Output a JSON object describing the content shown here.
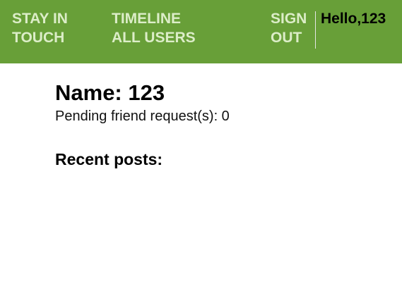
{
  "nav": {
    "brand_line1": "STAY IN",
    "brand_line2": "TOUCH",
    "timeline_label": "TIMELINE",
    "all_users_label": "ALL USERS",
    "signout_line1": "SIGN",
    "signout_line2": "OUT",
    "greeting": "Hello,123",
    "bg_color": "#689f38",
    "link_color": "#dcedc8"
  },
  "profile": {
    "name_heading": "Name: 123",
    "pending_requests": "Pending friend request(s): 0",
    "recent_posts_heading": "Recent posts:"
  }
}
